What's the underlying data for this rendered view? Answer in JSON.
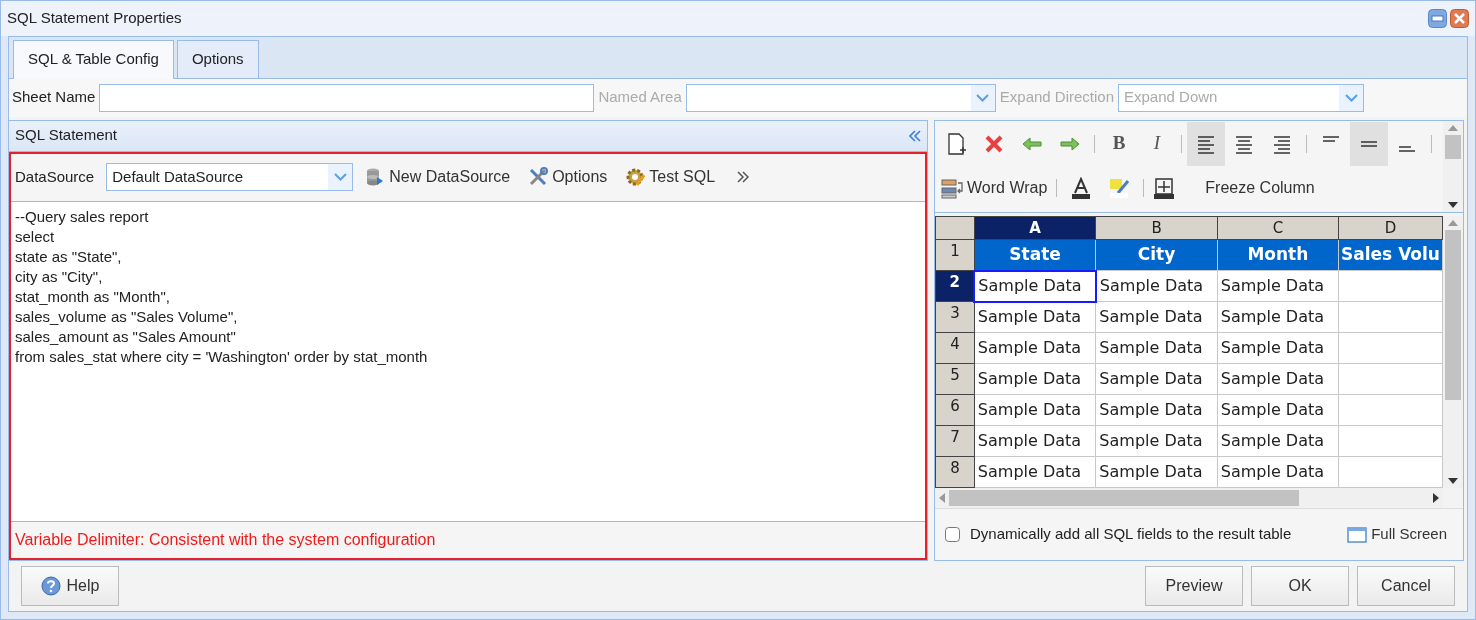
{
  "window": {
    "title": "SQL Statement Properties"
  },
  "tabs": [
    {
      "label": "SQL & Table Config",
      "selected": true
    },
    {
      "label": "Options",
      "selected": false
    }
  ],
  "fields": [
    {
      "label": "Sheet Name",
      "disabled": false,
      "kind": "text"
    },
    {
      "label": "Named Area",
      "disabled": true,
      "kind": "dropdown"
    },
    {
      "label": "Expand Direction",
      "disabled": true,
      "kind": "dropdown",
      "value": "Expand Down"
    }
  ],
  "sql_panel": {
    "title": "SQL Statement",
    "datasource_label": "DataSource",
    "datasource": "Default DataSource",
    "actions": [
      "New DataSource",
      "Options",
      "Test SQL"
    ],
    "code_lines": [
      "--Query sales report",
      "select",
      "state as \"State\",",
      "city as \"City\",",
      "stat_month as \"Month\",",
      "sales_volume as \"Sales Volume\",",
      "sales_amount as \"Sales Amount\"",
      "from sales_stat where city = 'Washington' order by stat_month"
    ],
    "footer_note": "Variable Delimiter: Consistent with the system configuration"
  },
  "toolbar": [
    {
      "kind": "button",
      "selected": false
    },
    {
      "kind": "button",
      "selected": false
    },
    {
      "kind": "button",
      "selected": false
    },
    {
      "kind": "button",
      "selected": false
    },
    {
      "kind": "separator"
    },
    {
      "kind": "glyph",
      "label": "B",
      "selected": false
    },
    {
      "kind": "glyph",
      "label": "I",
      "selected": false
    },
    {
      "kind": "separator"
    },
    {
      "kind": "button",
      "selected": true
    },
    {
      "kind": "button",
      "selected": false
    },
    {
      "kind": "button",
      "selected": false
    },
    {
      "kind": "separator"
    },
    {
      "kind": "button",
      "selected": false
    },
    {
      "kind": "button",
      "selected": true
    },
    {
      "kind": "button",
      "selected": false
    },
    {
      "kind": "separator"
    },
    {
      "kind": "labelled",
      "label": "Word Wrap",
      "selected": false
    },
    {
      "kind": "separator"
    },
    {
      "kind": "button",
      "selected": false
    },
    {
      "kind": "button",
      "selected": false
    },
    {
      "kind": "separator"
    },
    {
      "kind": "labelled",
      "label": "Freeze Column",
      "selected": false
    }
  ],
  "sheet": {
    "columns": [
      {
        "label": "A",
        "selected": true
      },
      {
        "label": "B",
        "selected": false
      },
      {
        "label": "C",
        "selected": false
      },
      {
        "label": "D",
        "selected": false
      }
    ],
    "rows": [
      {
        "label": "1",
        "selected": false,
        "kind": "header",
        "cells": [
          {
            "text": "State",
            "selected": false
          },
          {
            "text": "City",
            "selected": false
          },
          {
            "text": "Month",
            "selected": false
          },
          {
            "text": "Sales Volu",
            "selected": false
          }
        ]
      },
      {
        "label": "2",
        "selected": true,
        "kind": "data",
        "cells": [
          {
            "text": "Sample Data",
            "selected": true
          },
          {
            "text": "Sample Data",
            "selected": false
          },
          {
            "text": "Sample Data",
            "selected": false
          }
        ]
      },
      {
        "label": "3",
        "selected": false,
        "kind": "data",
        "cells": [
          {
            "text": "Sample Data",
            "selected": false
          },
          {
            "text": "Sample Data",
            "selected": false
          },
          {
            "text": "Sample Data",
            "selected": false
          }
        ]
      },
      {
        "label": "4",
        "selected": false,
        "kind": "data",
        "cells": [
          {
            "text": "Sample Data",
            "selected": false
          },
          {
            "text": "Sample Data",
            "selected": false
          },
          {
            "text": "Sample Data",
            "selected": false
          }
        ]
      },
      {
        "label": "5",
        "selected": false,
        "kind": "data",
        "cells": [
          {
            "text": "Sample Data",
            "selected": false
          },
          {
            "text": "Sample Data",
            "selected": false
          },
          {
            "text": "Sample Data",
            "selected": false
          }
        ]
      },
      {
        "label": "6",
        "selected": false,
        "kind": "data",
        "cells": [
          {
            "text": "Sample Data",
            "selected": false
          },
          {
            "text": "Sample Data",
            "selected": false
          },
          {
            "text": "Sample Data",
            "selected": false
          }
        ]
      },
      {
        "label": "7",
        "selected": false,
        "kind": "data",
        "cells": [
          {
            "text": "Sample Data",
            "selected": false
          },
          {
            "text": "Sample Data",
            "selected": false
          },
          {
            "text": "Sample Data",
            "selected": false
          }
        ]
      },
      {
        "label": "8",
        "selected": false,
        "kind": "data",
        "cells": [
          {
            "text": "Sample Data",
            "selected": false
          },
          {
            "text": "Sample Data",
            "selected": false
          },
          {
            "text": "Sample Data",
            "selected": false
          }
        ]
      }
    ]
  },
  "dynamic_fields": {
    "label": "Dynamically add all SQL fields to the result table",
    "checked": false
  },
  "full_screen": "Full Screen",
  "buttons": {
    "left": [
      "Help"
    ],
    "right": [
      "Preview",
      "OK",
      "Cancel"
    ]
  }
}
